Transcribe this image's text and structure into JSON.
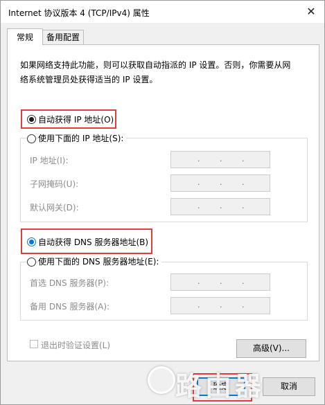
{
  "window": {
    "title": "Internet 协议版本 4 (TCP/IPv4) 属性",
    "close_glyph": "✕"
  },
  "tabs": [
    {
      "label": "常规",
      "active": true
    },
    {
      "label": "备用配置",
      "active": false
    }
  ],
  "description_line1": "如果网络支持此功能，则可以获取自动指派的 IP 设置。否则，你需要从网",
  "description_line2": "络系统管理员处获得适当的 IP 设置。",
  "ip_section": {
    "auto_option": {
      "label": "自动获得 IP 地址(O)",
      "selected": true
    },
    "manual_option": {
      "label": "使用下面的 IP 地址(S):",
      "selected": false
    },
    "fields": [
      {
        "label": "IP 地址(I):",
        "value": ". . ."
      },
      {
        "label": "子网掩码(U):",
        "value": ". . ."
      },
      {
        "label": "默认网关(D):",
        "value": ". . ."
      }
    ]
  },
  "dns_section": {
    "auto_option": {
      "label": "自动获得 DNS 服务器地址(B)",
      "selected": true
    },
    "manual_option": {
      "label": "使用下面的 DNS 服务器地址(E):",
      "selected": false
    },
    "fields": [
      {
        "label": "首选 DNS 服务器(P):",
        "value": ". . ."
      },
      {
        "label": "备用 DNS 服务器(A):",
        "value": ". . ."
      }
    ]
  },
  "validate_checkbox": {
    "label": "退出时验证设置(L)",
    "checked": false
  },
  "buttons": {
    "advanced": "高级(V)...",
    "ok": "确定",
    "cancel": "取消"
  },
  "watermark": {
    "text": "路由器"
  },
  "colors": {
    "highlight_border": "#e23b3b",
    "accent": "#0078d7"
  }
}
